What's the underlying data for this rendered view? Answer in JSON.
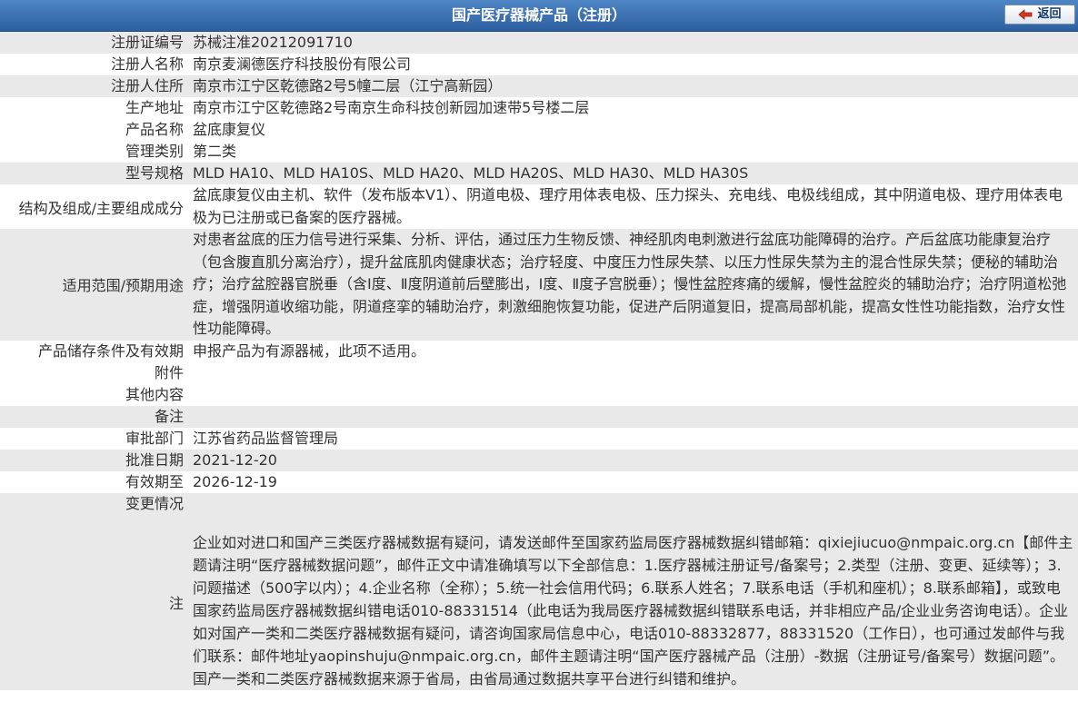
{
  "header": {
    "title": "国产医疗器械产品（注册）",
    "back_label": "返回"
  },
  "rows": [
    {
      "label": "注册证编号",
      "value": "苏械注准20212091710"
    },
    {
      "label": "注册人名称",
      "value": "南京麦澜德医疗科技股份有限公司"
    },
    {
      "label": "注册人住所",
      "value": "南京市江宁区乾德路2号5幢二层（江宁高新园）"
    },
    {
      "label": "生产地址",
      "value": "南京市江宁区乾德路2号南京生命科技创新园加速带5号楼二层"
    },
    {
      "label": "产品名称",
      "value": "盆底康复仪"
    },
    {
      "label": "管理类别",
      "value": "第二类"
    },
    {
      "label": "型号规格",
      "value": "MLD HA10、MLD HA10S、MLD HA20、MLD HA20S、MLD HA30、MLD HA30S"
    },
    {
      "label": "结构及组成/主要组成成分",
      "value": "盆底康复仪由主机、软件（发布版本V1）、阴道电极、理疗用体表电极、压力探头、充电线、电极线组成，其中阴道电极、理疗用体表电极为已注册或已备案的医疗器械。"
    },
    {
      "label": "适用范围/预期用途",
      "value": "对患者盆底的压力信号进行采集、分析、评估，通过压力生物反馈、神经肌肉电刺激进行盆底功能障碍的治疗。产后盆底功能康复治疗（包含腹直肌分离治疗），提升盆底肌肉健康状态；治疗轻度、中度压力性尿失禁、以压力性尿失禁为主的混合性尿失禁；便秘的辅助治疗；治疗盆腔器官脱垂（含Ⅰ度、Ⅱ度阴道前后壁膨出，Ⅰ度、Ⅱ度子宫脱垂）；慢性盆腔疼痛的缓解，慢性盆腔炎的辅助治疗；治疗阴道松弛症，增强阴道收缩功能，阴道痉挛的辅助治疗，刺激细胞恢复功能，促进产后阴道复旧，提高局部机能，提高女性性功能指数，治疗女性性功能障碍。"
    },
    {
      "label": "产品储存条件及有效期",
      "value": "申报产品为有源器械，此项不适用。"
    },
    {
      "label": "附件",
      "value": ""
    },
    {
      "label": "其他内容",
      "value": ""
    },
    {
      "label": "备注",
      "value": ""
    },
    {
      "label": "审批部门",
      "value": "江苏省药品监督管理局"
    },
    {
      "label": "批准日期",
      "value": "2021-12-20"
    },
    {
      "label": "有效期至",
      "value": "2026-12-19"
    },
    {
      "label": "变更情况",
      "value": ""
    },
    {
      "label": "注",
      "value": "企业如对进口和国产三类医疗器械数据有疑问，请发送邮件至国家药监局医疗器械数据纠错邮箱：qixiejiucuo@nmpaic.org.cn【邮件主题请注明“医疗器械数据问题”，邮件正文中请准确填写以下全部信息：1.医疗器械注册证号/备案号；2.类型（注册、变更、延续等）；3.问题描述（500字以内）；4.企业名称（全称）；5.统一社会信用代码；6.联系人姓名；7.联系电话（手机和座机）；8.联系邮箱】，或致电国家药监局医疗器械数据纠错电话010-88331514（此电话为我局医疗器械数据纠错联系电话，并非相应产品/企业业务咨询电话）。企业如对国产一类和二类医疗器械数据有疑问，请咨询国家局信息中心，电话010-88332877，88331520（工作日），也可通过发邮件与我们联系：邮件地址yaopinshuju@nmpaic.org.cn，邮件主题请注明“国产医疗器械产品（注册）-数据（注册证号/备案号）数据问题”。国产一类和二类医疗器械数据来源于省局，由省局通过数据共享平台进行纠错和维护。"
    }
  ]
}
